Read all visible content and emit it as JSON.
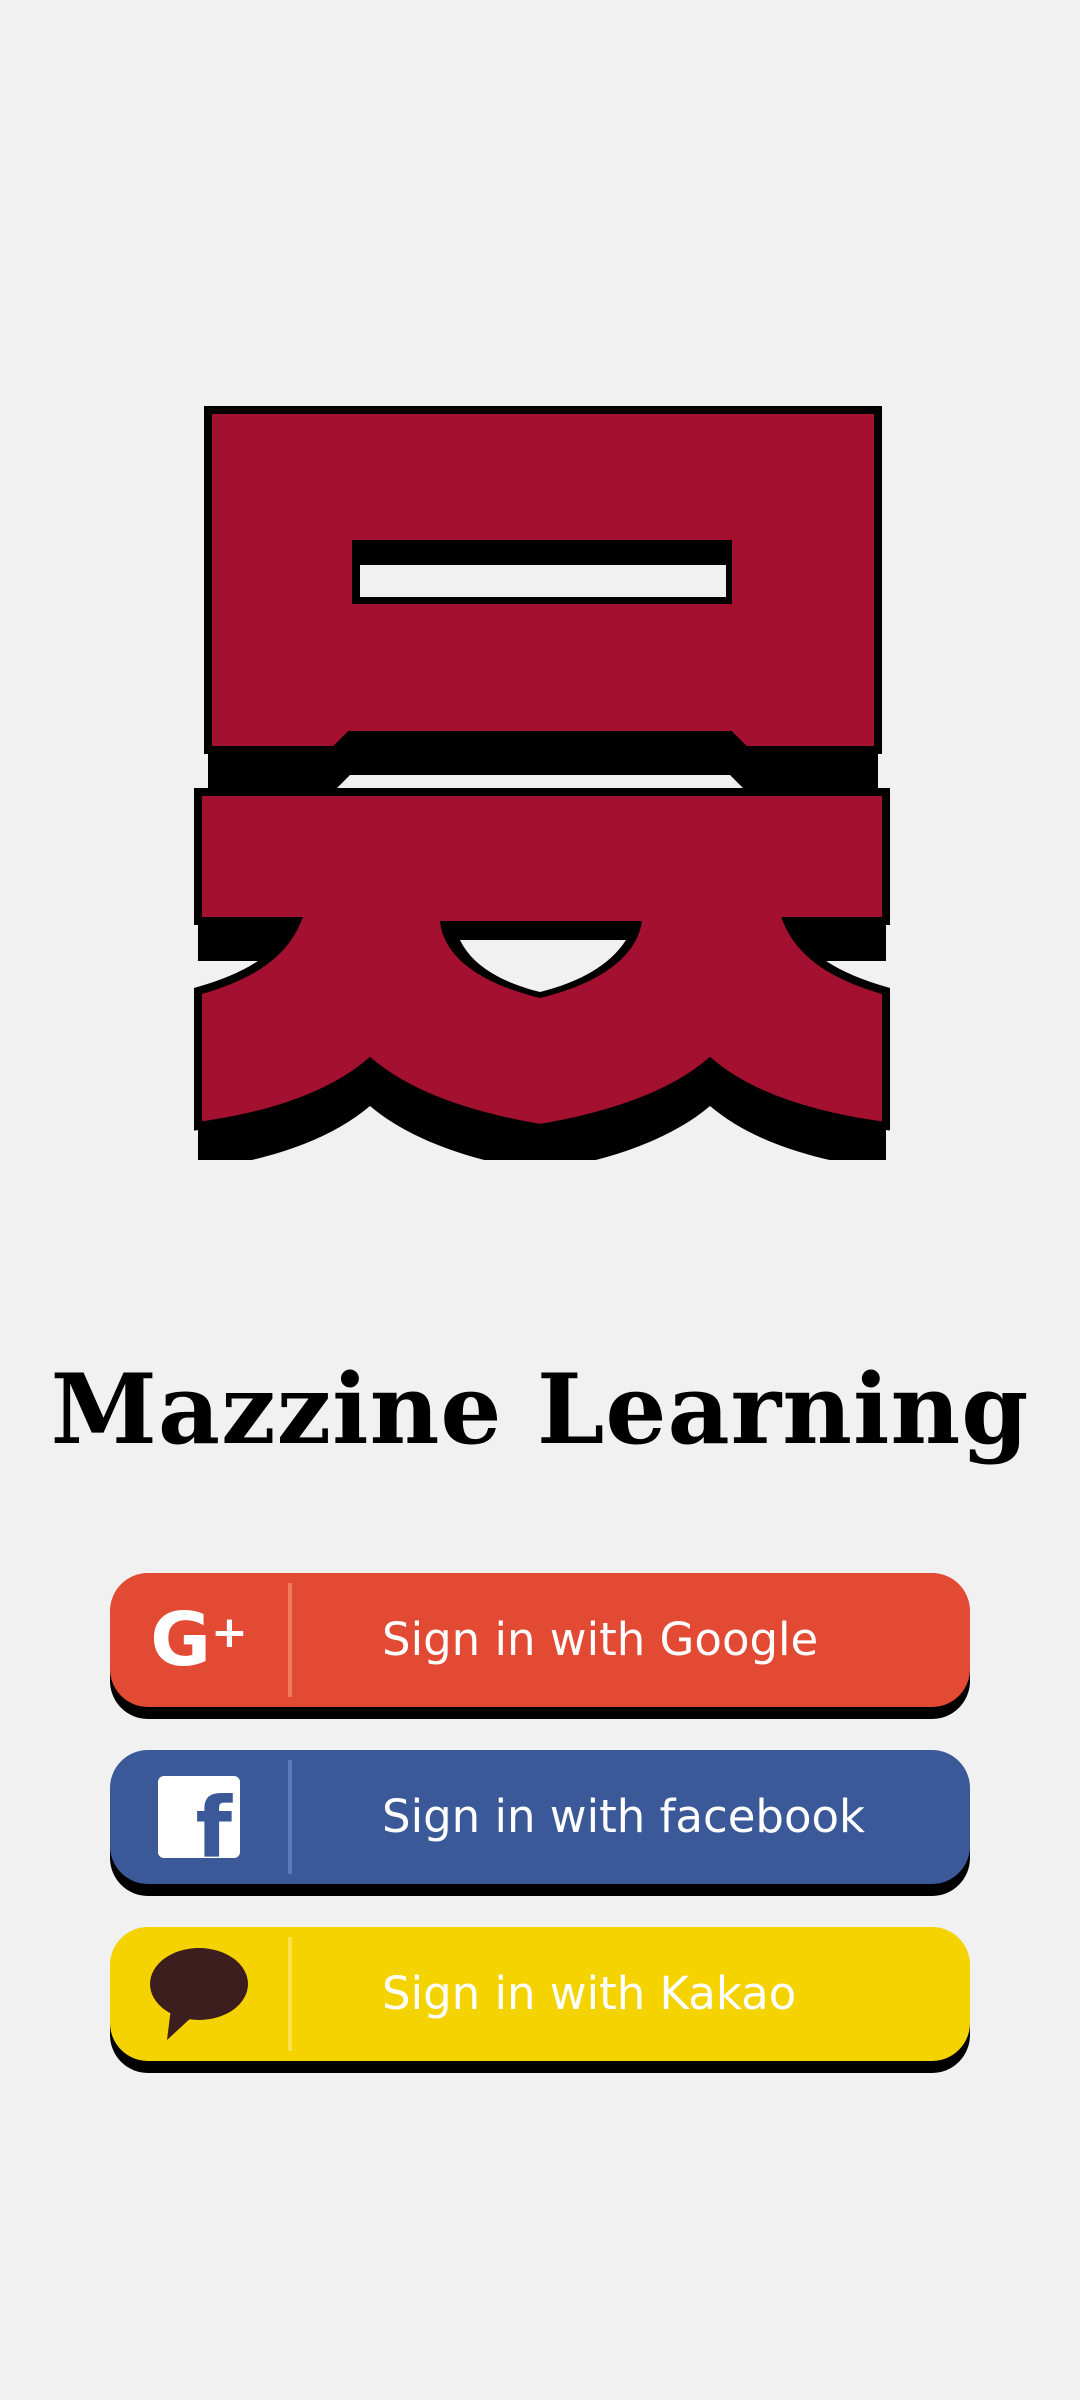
{
  "app": {
    "title": "Mazzine Learning"
  },
  "logo": {
    "icon": "hangul-logo-icon",
    "colors": {
      "fill": "#a31030",
      "outline": "#000000",
      "inner": "#f1f1f1"
    }
  },
  "auth": {
    "google": {
      "label": "Sign in with Google",
      "icon": "google-plus-icon",
      "icon_text": "G",
      "icon_plus": "+",
      "color": "#e24a33"
    },
    "facebook": {
      "label": "Sign in with facebook",
      "icon": "facebook-icon",
      "icon_text": "f",
      "color": "#3b5998"
    },
    "kakao": {
      "label": "Sign in with Kakao",
      "icon": "kakao-talk-icon",
      "color": "#f5d300"
    }
  }
}
